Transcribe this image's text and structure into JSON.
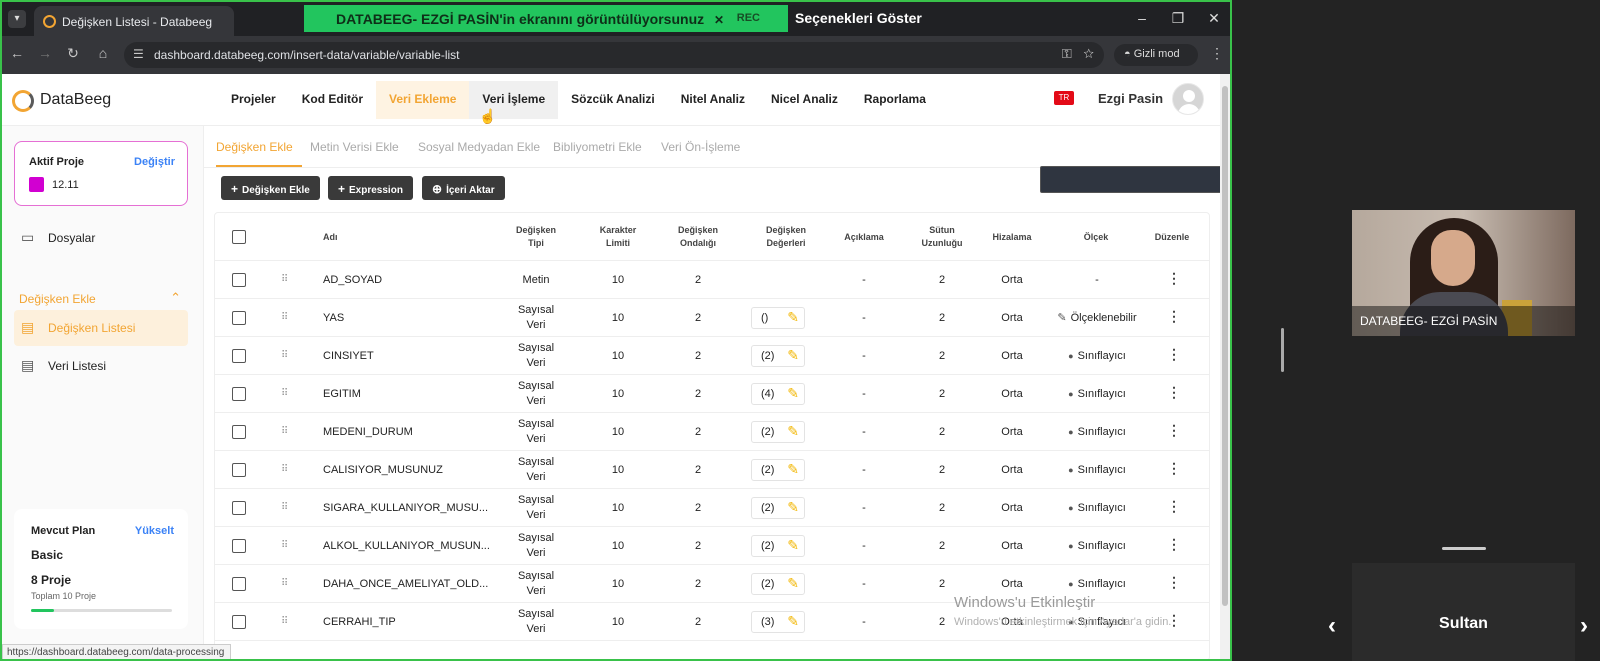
{
  "browser": {
    "tab_title": "Değişken Listesi - Databeeg",
    "url": "dashboard.databeeg.com/insert-data/variable/variable-list",
    "incognito_label": "Gizli mod",
    "status_url": "https://dashboard.databeeg.com/data-processing"
  },
  "share_bar": {
    "message": "DATABEEG- EZGİ PASİN'in ekranını görüntülüyorsunuz",
    "rec_label": "REC",
    "options_label": "Seçenekleri Göster"
  },
  "app": {
    "brand": "DataBeeg",
    "nav": [
      "Projeler",
      "Kod Editör",
      "Veri Ekleme",
      "Veri İşleme",
      "Sözcük Analizi",
      "Nitel Analiz",
      "Nicel Analiz",
      "Raporlama"
    ],
    "active_nav": "Veri Ekleme",
    "flag_label": "TR",
    "user_name": "Ezgi Pasin"
  },
  "sidebar": {
    "project_title": "Aktif Proje",
    "change_label": "Değiştir",
    "project_name": "12.11",
    "project_color": "#d100d1",
    "files_label": "Dosyalar",
    "section_label": "Değişken Ekle",
    "items": [
      "Değişken Listesi",
      "Veri Listesi"
    ],
    "plan": {
      "title": "Mevcut Plan",
      "upgrade": "Yükselt",
      "name": "Basic",
      "projects": "8 Proje",
      "total": "Toplam 10 Proje",
      "usage_fraction": 0.16
    }
  },
  "subtabs": [
    "Değişken Ekle",
    "Metin Verisi Ekle",
    "Sosyal Medyadan Ekle",
    "Bibliyometri Ekle",
    "Veri Ön-İşleme"
  ],
  "actions": {
    "add_variable": "Değişken Ekle",
    "expression": "Expression",
    "import": "İçeri Aktar"
  },
  "table": {
    "headers": {
      "name": "Adı",
      "type": "Değişken Tipi",
      "char_limit": "Karakter Limiti",
      "decimal": "Değişken Ondalığı",
      "values": "Değişken Değerleri",
      "description": "Açıklama",
      "col_width": "Sütun Uzunluğu",
      "align": "Hizalama",
      "scale": "Ölçek",
      "edit": "Düzenle"
    },
    "rows": [
      {
        "name": "AD_SOYAD",
        "type": "Metin",
        "limit": "10",
        "decimal": "2",
        "values": "",
        "desc": "-",
        "width": "2",
        "align": "Orta",
        "scale": "-"
      },
      {
        "name": "YAS",
        "type": "Sayısal Veri",
        "limit": "10",
        "decimal": "2",
        "values": "()",
        "desc": "-",
        "width": "2",
        "align": "Orta",
        "scale": "Ölçeklenebilir"
      },
      {
        "name": "CINSIYET",
        "type": "Sayısal Veri",
        "limit": "10",
        "decimal": "2",
        "values": "(2)",
        "desc": "-",
        "width": "2",
        "align": "Orta",
        "scale": "Sınıflayıcı"
      },
      {
        "name": "EGITIM",
        "type": "Sayısal Veri",
        "limit": "10",
        "decimal": "2",
        "values": "(4)",
        "desc": "-",
        "width": "2",
        "align": "Orta",
        "scale": "Sınıflayıcı"
      },
      {
        "name": "MEDENI_DURUM",
        "type": "Sayısal Veri",
        "limit": "10",
        "decimal": "2",
        "values": "(2)",
        "desc": "-",
        "width": "2",
        "align": "Orta",
        "scale": "Sınıflayıcı"
      },
      {
        "name": "CALISIYOR_MUSUNUZ",
        "type": "Sayısal Veri",
        "limit": "10",
        "decimal": "2",
        "values": "(2)",
        "desc": "-",
        "width": "2",
        "align": "Orta",
        "scale": "Sınıflayıcı"
      },
      {
        "name": "SIGARA_KULLANIYOR_MUSU...",
        "type": "Sayısal Veri",
        "limit": "10",
        "decimal": "2",
        "values": "(2)",
        "desc": "-",
        "width": "2",
        "align": "Orta",
        "scale": "Sınıflayıcı"
      },
      {
        "name": "ALKOL_KULLANIYOR_MUSUN...",
        "type": "Sayısal Veri",
        "limit": "10",
        "decimal": "2",
        "values": "(2)",
        "desc": "-",
        "width": "2",
        "align": "Orta",
        "scale": "Sınıflayıcı"
      },
      {
        "name": "DAHA_ONCE_AMELIYAT_OLD...",
        "type": "Sayısal Veri",
        "limit": "10",
        "decimal": "2",
        "values": "(2)",
        "desc": "-",
        "width": "2",
        "align": "Orta",
        "scale": "Sınıflayıcı"
      },
      {
        "name": "CERRAHI_TIP",
        "type": "Sayısal Veri",
        "limit": "10",
        "decimal": "2",
        "values": "(3)",
        "desc": "-",
        "width": "2",
        "align": "Orta",
        "scale": "Sınıflayıcı"
      }
    ]
  },
  "windows_notice": {
    "title": "Windows'u Etkinleştir",
    "subtitle": "Windows'u etkinleştirmek için Ayarlar'a gidin."
  },
  "video": {
    "presenter_name": "DATABEEG- EZGİ PASİN",
    "participant_name": "Sultan"
  }
}
